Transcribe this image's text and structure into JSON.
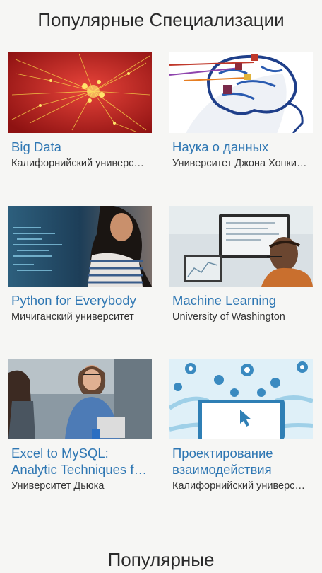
{
  "sections": {
    "popular_specializations_title": "Популярные Специализации",
    "popular_next_title": "Популярные"
  },
  "cards": [
    {
      "title": "Big Data",
      "subtitle": "Калифорнийский университет в Сан-Диего",
      "image": "red-network-image"
    },
    {
      "title": "Наука о данных",
      "subtitle": "Университет Джона Хопкинса",
      "image": "brain-diagram-image"
    },
    {
      "title": "Python for Everybody",
      "subtitle": "Мичиганский университет",
      "image": "student-coding-image"
    },
    {
      "title": "Machine Learning",
      "subtitle": "University of Washington",
      "image": "man-at-computer-image"
    },
    {
      "title": "Excel to MySQL: Analytic Techniques for Business",
      "subtitle": "Университет Дьюка",
      "image": "women-laptop-image"
    },
    {
      "title": "Проектирование взаимодействия",
      "subtitle": "Калифорнийский университет в Сан-Диего",
      "image": "interaction-icons-image"
    }
  ]
}
